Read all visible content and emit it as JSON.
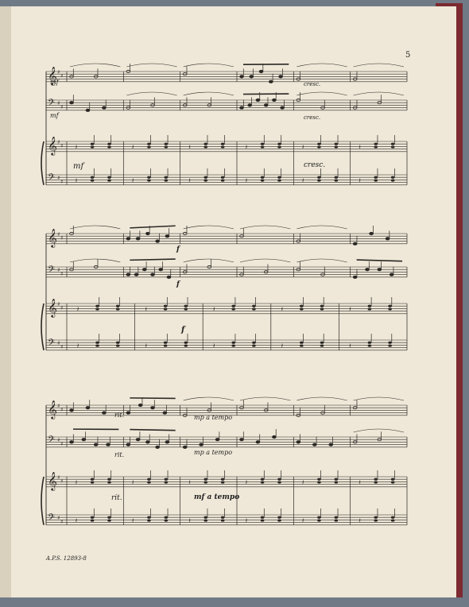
{
  "page": {
    "number": "5",
    "footer": "A.P.S. 12893-8"
  },
  "systems": [
    {
      "violin_markings": [
        "mf",
        "cresc."
      ],
      "cello_markings": [
        "mf",
        "cresc."
      ],
      "piano_markings": [
        "mf",
        "cresc."
      ]
    },
    {
      "violin_markings": [
        "f"
      ],
      "cello_markings": [
        "f"
      ],
      "piano_markings": [
        "f"
      ]
    },
    {
      "violin_markings": [
        "rit.",
        "mp a tempo"
      ],
      "cello_markings": [
        "rit.",
        "mp a tempo"
      ],
      "piano_markings": [
        "rit.",
        "mf a tempo"
      ]
    }
  ],
  "colors": {
    "paper": "#efe8d8",
    "ink": "#2a2724",
    "binding": "#7d2a30",
    "background": "#6f7a86"
  }
}
